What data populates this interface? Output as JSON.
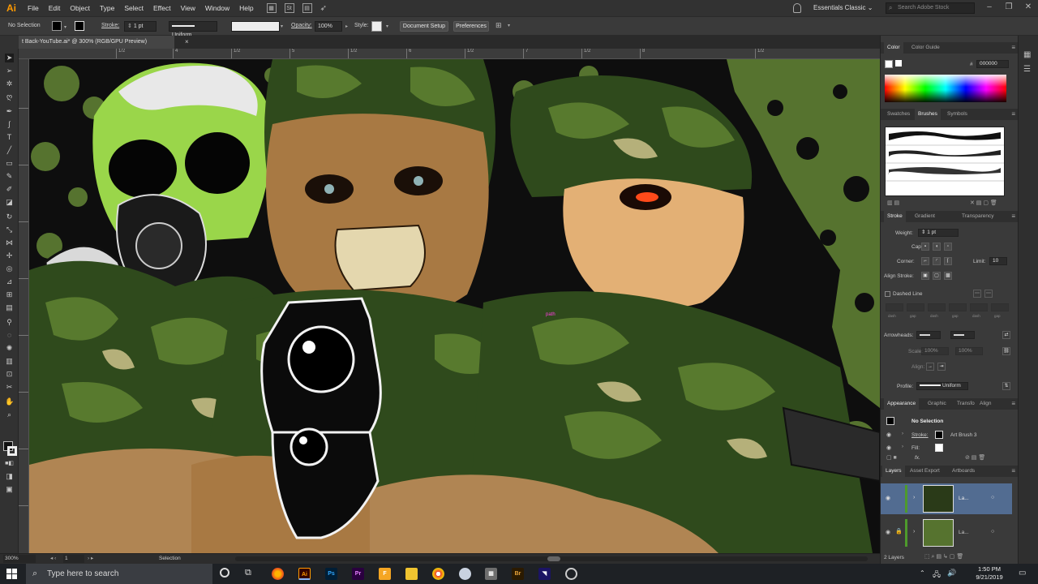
{
  "app": {
    "logo": "Ai"
  },
  "menu": [
    "File",
    "Edit",
    "Object",
    "Type",
    "Select",
    "Effect",
    "View",
    "Window",
    "Help"
  ],
  "workspace": {
    "label": "Essentials Classic",
    "caret": "⌄"
  },
  "search_stock": {
    "placeholder": "Search Adobe Stock"
  },
  "control_bar": {
    "selection": "No Selection",
    "stroke_label": "Stroke:",
    "stroke_weight": "1 pt",
    "stroke_profile": "Uniform",
    "opacity_label": "Opacity:",
    "opacity_value": "100%",
    "style_label": "Style:",
    "document_setup": "Document Setup",
    "preferences": "Preferences"
  },
  "document_tab": {
    "title": "t Back-YouTube.ai* @ 300% (RGB/GPU Preview)",
    "close": "×"
  },
  "ruler_marks": [
    "1/2",
    "4",
    "1/2",
    "5",
    "1/2",
    "6",
    "1/2",
    "7",
    "1/2",
    "8",
    "1/2"
  ],
  "canvas": {
    "path_label": "path"
  },
  "status_bar": {
    "zoom": "300%",
    "artboard": "1",
    "mode": "Selection"
  },
  "panels": {
    "color": {
      "tabs": [
        "Color",
        "Color Guide"
      ],
      "hex_prefix": "#",
      "hex": "000000"
    },
    "brushes": {
      "tabs": [
        "Swatches",
        "Brushes",
        "Symbols"
      ]
    },
    "stroke": {
      "tabs": [
        "Stroke",
        "Gradient",
        "Transparency"
      ],
      "weight_label": "Weight:",
      "weight_value": "1 pt",
      "cap_label": "Cap:",
      "corner_label": "Corner:",
      "limit_label": "Limit:",
      "limit_value": "10",
      "align_label": "Align Stroke:",
      "dashed_label": "Dashed Line",
      "dash_labels": [
        "dash",
        "gap",
        "dash",
        "gap",
        "dash",
        "gap"
      ],
      "arrowheads_label": "Arrowheads:",
      "scale_label": "Scale:",
      "scale_values": [
        "100%",
        "100%"
      ],
      "align_arrows_label": "Align:",
      "profile_label": "Profile:",
      "profile_value": "Uniform"
    },
    "appearance": {
      "tabs": [
        "Appearance",
        "Graphic",
        "Transfo",
        "Align"
      ],
      "title": "No Selection",
      "stroke_label": "Stroke:",
      "stroke_brush": "Art Brush 3",
      "fill_label": "Fill:",
      "fx": "fx."
    },
    "layers": {
      "tabs": [
        "Layers",
        "Asset Export",
        "Artboards"
      ],
      "rows": [
        {
          "name": "La...",
          "selected": true
        },
        {
          "name": "La...",
          "selected": false
        }
      ],
      "count": "2 Layers"
    }
  },
  "taskbar": {
    "search_placeholder": "Type here to search",
    "apps": [
      "Ai",
      "Ps",
      "Pr",
      "F",
      "Br"
    ],
    "time": "1:50 PM",
    "date": "9/21/2019"
  },
  "colors": {
    "accent_orange": "#ff9a00",
    "camo_dark": "#2f4a1c",
    "camo_mid": "#587a2e",
    "bg_green": "#56732f",
    "skin": "#b08553",
    "skull_green": "#9ad64a"
  }
}
